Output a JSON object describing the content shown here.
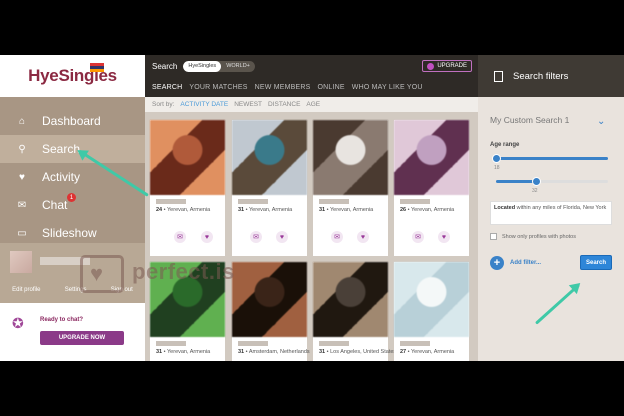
{
  "sidebar": {
    "logo": "HyeSingles",
    "nav": [
      {
        "label": "Dashboard",
        "icon": "home-icon",
        "glyph": "⌂"
      },
      {
        "label": "Search",
        "icon": "search-icon",
        "glyph": "⚲"
      },
      {
        "label": "Activity",
        "icon": "heartbeat-icon",
        "glyph": "♥"
      },
      {
        "label": "Chat",
        "icon": "chat-icon",
        "glyph": "✉",
        "badge": "1"
      },
      {
        "label": "Slideshow",
        "icon": "slideshow-icon",
        "glyph": "▭"
      }
    ],
    "profile_links": [
      "Edit profile",
      "Settings",
      "Sign out"
    ],
    "ready_to_chat": "Ready to chat?",
    "upgrade_now": "UPGRADE NOW"
  },
  "main": {
    "title": "Search",
    "pills": [
      "HyeSingles",
      "WORLD+"
    ],
    "upgrade": "UPGRADE",
    "tabs": [
      "SEARCH",
      "YOUR MATCHES",
      "NEW MEMBERS",
      "ONLINE",
      "WHO MAY LIKE YOU"
    ],
    "sort_label": "Sort by:",
    "sort_options": [
      "ACTIVITY DATE",
      "NEWEST",
      "DISTANCE",
      "AGE"
    ],
    "cards": [
      {
        "age": "24",
        "location": "Yerevan, Armenia",
        "colors": [
          "#b05a3a",
          "#e09060",
          "#6a2a1a"
        ]
      },
      {
        "age": "31",
        "location": "Yerevan, Armenia",
        "colors": [
          "#3a7a8a",
          "#c0c8d0",
          "#5a4a3a"
        ]
      },
      {
        "age": "31",
        "location": "Yerevan, Armenia",
        "colors": [
          "#e8e4e0",
          "#4a3a30",
          "#8a7a70"
        ]
      },
      {
        "age": "26",
        "location": "Yerevan, Armenia",
        "colors": [
          "#c0a0c0",
          "#e0c8d8",
          "#603050"
        ]
      },
      {
        "age": "31",
        "location": "Yerevan, Armenia",
        "colors": [
          "#2a6a2a",
          "#60b050",
          "#204020"
        ]
      },
      {
        "age": "31",
        "location": "Amsterdam, Netherlands",
        "colors": [
          "#3a2418",
          "#a06040",
          "#1a1008"
        ]
      },
      {
        "age": "31",
        "location": "Los Angeles, United States",
        "colors": [
          "#4a4038",
          "#a08870",
          "#201810"
        ]
      },
      {
        "age": "27",
        "location": "Yerevan, Armenia",
        "colors": [
          "#f4f8f8",
          "#d8e8ec",
          "#b8d0d8"
        ]
      }
    ]
  },
  "filters": {
    "header": "Search filters",
    "custom_search": "My Custom Search 1",
    "age_range_label": "Age range",
    "age_min": "18",
    "age_max": "32",
    "located_label": "Located",
    "located_text": "within any miles of Florida, New York",
    "photos_only": "Show only profiles with photos",
    "add_filter": "Add filter...",
    "search_button": "Search"
  },
  "watermark": "perfect.is",
  "colors": {
    "sidebar": "#a89684",
    "accent_blue": "#2e86d8",
    "annotation_arrow": "#3fc9a7"
  }
}
